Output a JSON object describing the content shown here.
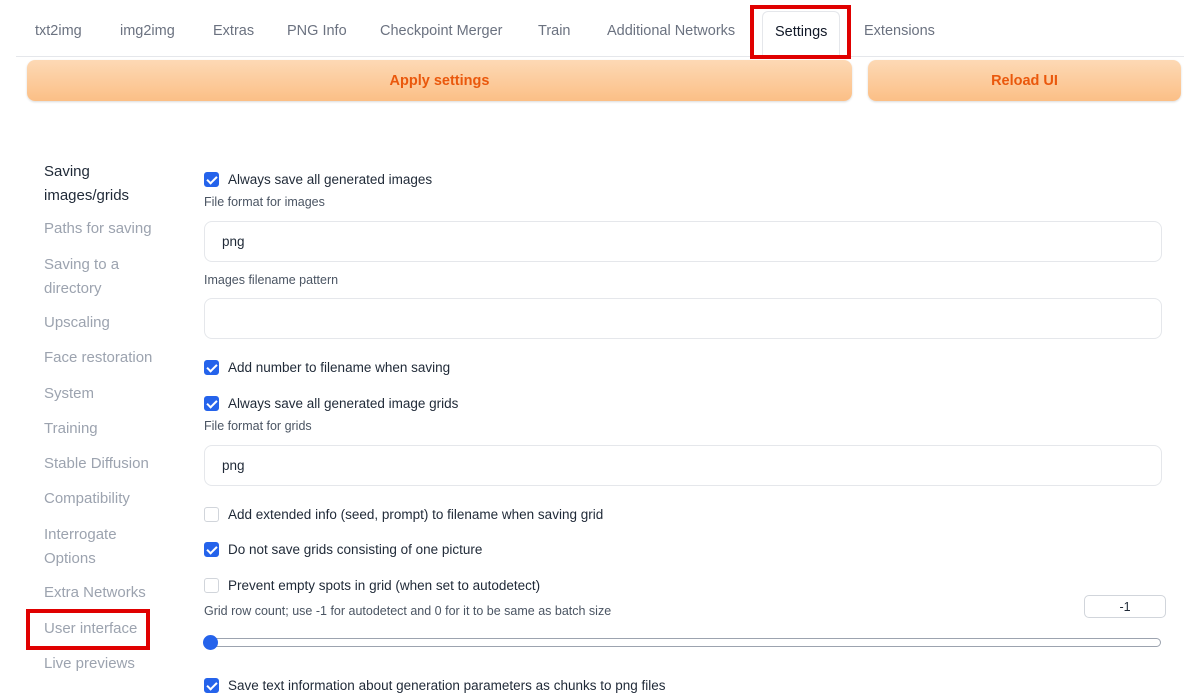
{
  "tabs": [
    {
      "label": "txt2img"
    },
    {
      "label": "img2img"
    },
    {
      "label": "Extras"
    },
    {
      "label": "PNG Info"
    },
    {
      "label": "Checkpoint Merger"
    },
    {
      "label": "Train"
    },
    {
      "label": "Additional Networks"
    },
    {
      "label": "Settings"
    },
    {
      "label": "Extensions"
    }
  ],
  "active_tab": "Settings",
  "buttons": {
    "apply": "Apply settings",
    "reload": "Reload UI"
  },
  "sidebar": {
    "active": "Saving images/grids",
    "highlighted": "User interface",
    "items": [
      {
        "label": "Saving images/grids"
      },
      {
        "label": "Paths for saving"
      },
      {
        "label": "Saving to a directory"
      },
      {
        "label": "Upscaling"
      },
      {
        "label": "Face restoration"
      },
      {
        "label": "System"
      },
      {
        "label": "Training"
      },
      {
        "label": "Stable Diffusion"
      },
      {
        "label": "Compatibility"
      },
      {
        "label": "Interrogate Options"
      },
      {
        "label": "Extra Networks"
      },
      {
        "label": "User interface"
      },
      {
        "label": "Live previews"
      }
    ]
  },
  "settings": {
    "save_all_images": {
      "label": "Always save all generated images",
      "checked": true
    },
    "file_format_images": {
      "label": "File format for images",
      "value": "png"
    },
    "filename_pattern": {
      "label": "Images filename pattern",
      "value": ""
    },
    "add_number": {
      "label": "Add number to filename when saving",
      "checked": true
    },
    "save_all_grids": {
      "label": "Always save all generated image grids",
      "checked": true
    },
    "file_format_grids": {
      "label": "File format for grids",
      "value": "png"
    },
    "extended_info": {
      "label": "Add extended info (seed, prompt) to filename when saving grid",
      "checked": false
    },
    "no_single_grid": {
      "label": "Do not save grids consisting of one picture",
      "checked": true
    },
    "prevent_empty": {
      "label": "Prevent empty spots in grid (when set to autodetect)",
      "checked": false
    },
    "grid_rows": {
      "label": "Grid row count; use -1 for autodetect and 0 for it to be same as batch size",
      "value": "-1"
    },
    "save_text_info": {
      "label": "Save text information about generation parameters as chunks to png files",
      "checked": true
    }
  },
  "colors": {
    "accent": "#2563eb",
    "button_text": "#ea580c",
    "highlight": "#e00000"
  }
}
